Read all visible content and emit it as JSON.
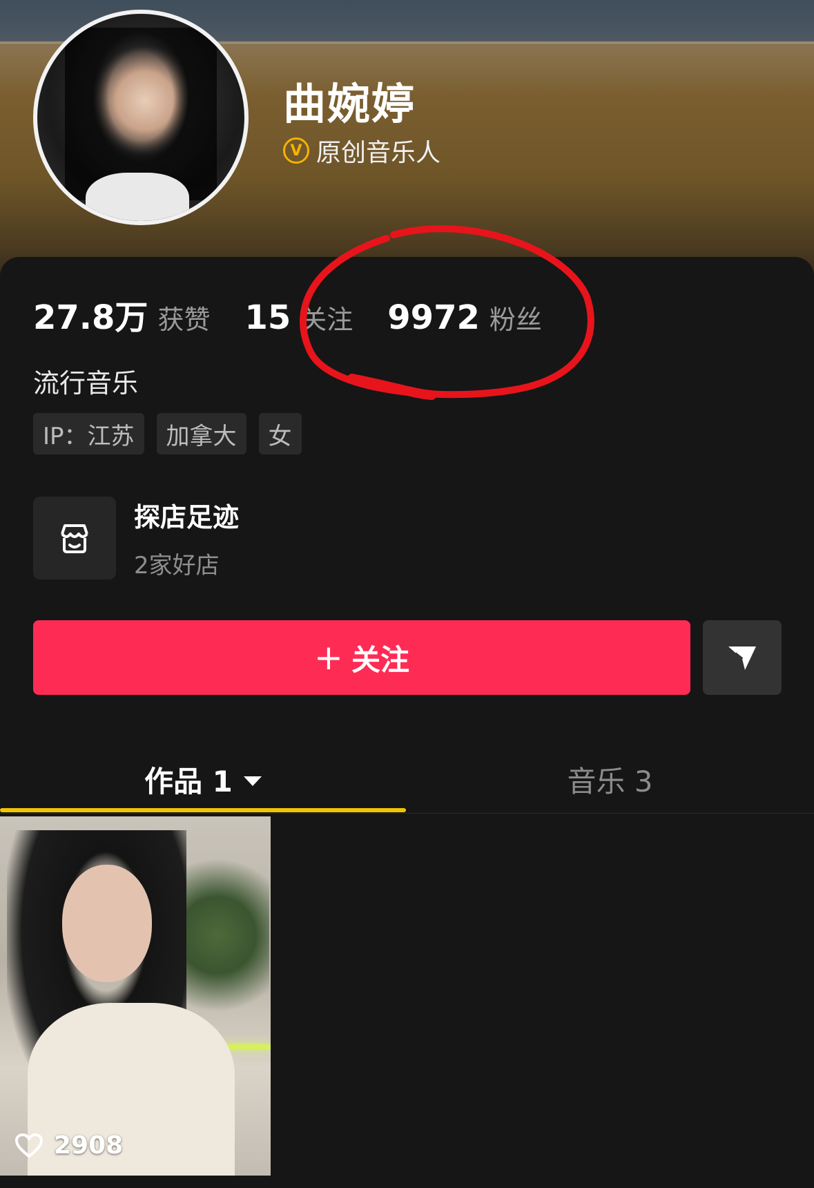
{
  "profile": {
    "name": "曲婉婷",
    "verification": "原创音乐人",
    "verify_badge": "V"
  },
  "stats": [
    {
      "value": "27.8万",
      "label": "获赞"
    },
    {
      "value": "15",
      "label": "关注"
    },
    {
      "value": "9972",
      "label": "粉丝"
    }
  ],
  "bio": "流行音乐",
  "tags": [
    "IP：江苏",
    "加拿大",
    "女"
  ],
  "store": {
    "title": "探店足迹",
    "subtitle": "2家好店",
    "icon": "store-icon"
  },
  "actions": {
    "follow_plus": "+",
    "follow_label": "关注",
    "share_icon": "send-icon"
  },
  "tabs": [
    {
      "label": "作品 1",
      "active": true
    },
    {
      "label": "音乐 3",
      "active": false
    }
  ],
  "videos": [
    {
      "likes": "2908"
    }
  ],
  "colors": {
    "follow_button": "#fe2c55",
    "tab_underline": "#f5c400",
    "verify_badge": "#f5b400",
    "annotation": "#e8141c"
  }
}
